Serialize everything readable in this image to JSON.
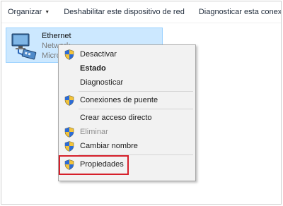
{
  "toolbar": {
    "organize_label": "Organizar",
    "disable_label": "Deshabilitar este dispositivo de red",
    "diagnose_label": "Diagnosticar esta conexión"
  },
  "adapter": {
    "name": "Ethernet",
    "line2": "Network",
    "line3": "Microsoft",
    "icon": "network-adapter-icon"
  },
  "context_menu": {
    "items": [
      {
        "label": "Desactivar",
        "shield": true,
        "bold": false,
        "enabled": true
      },
      {
        "label": "Estado",
        "shield": false,
        "bold": true,
        "enabled": true
      },
      {
        "label": "Diagnosticar",
        "shield": false,
        "bold": false,
        "enabled": true
      },
      {
        "label": "Conexiones de puente",
        "shield": true,
        "bold": false,
        "enabled": true
      },
      {
        "label": "Crear acceso directo",
        "shield": false,
        "bold": false,
        "enabled": true
      },
      {
        "label": "Eliminar",
        "shield": true,
        "bold": false,
        "enabled": false
      },
      {
        "label": "Cambiar nombre",
        "shield": true,
        "bold": false,
        "enabled": true
      },
      {
        "label": "Propiedades",
        "shield": true,
        "bold": false,
        "enabled": true,
        "highlighted": true
      }
    ]
  },
  "colors": {
    "selection_bg": "#cce8ff",
    "highlight_border": "#d61f2a",
    "menu_bg": "#f2f2f2"
  }
}
